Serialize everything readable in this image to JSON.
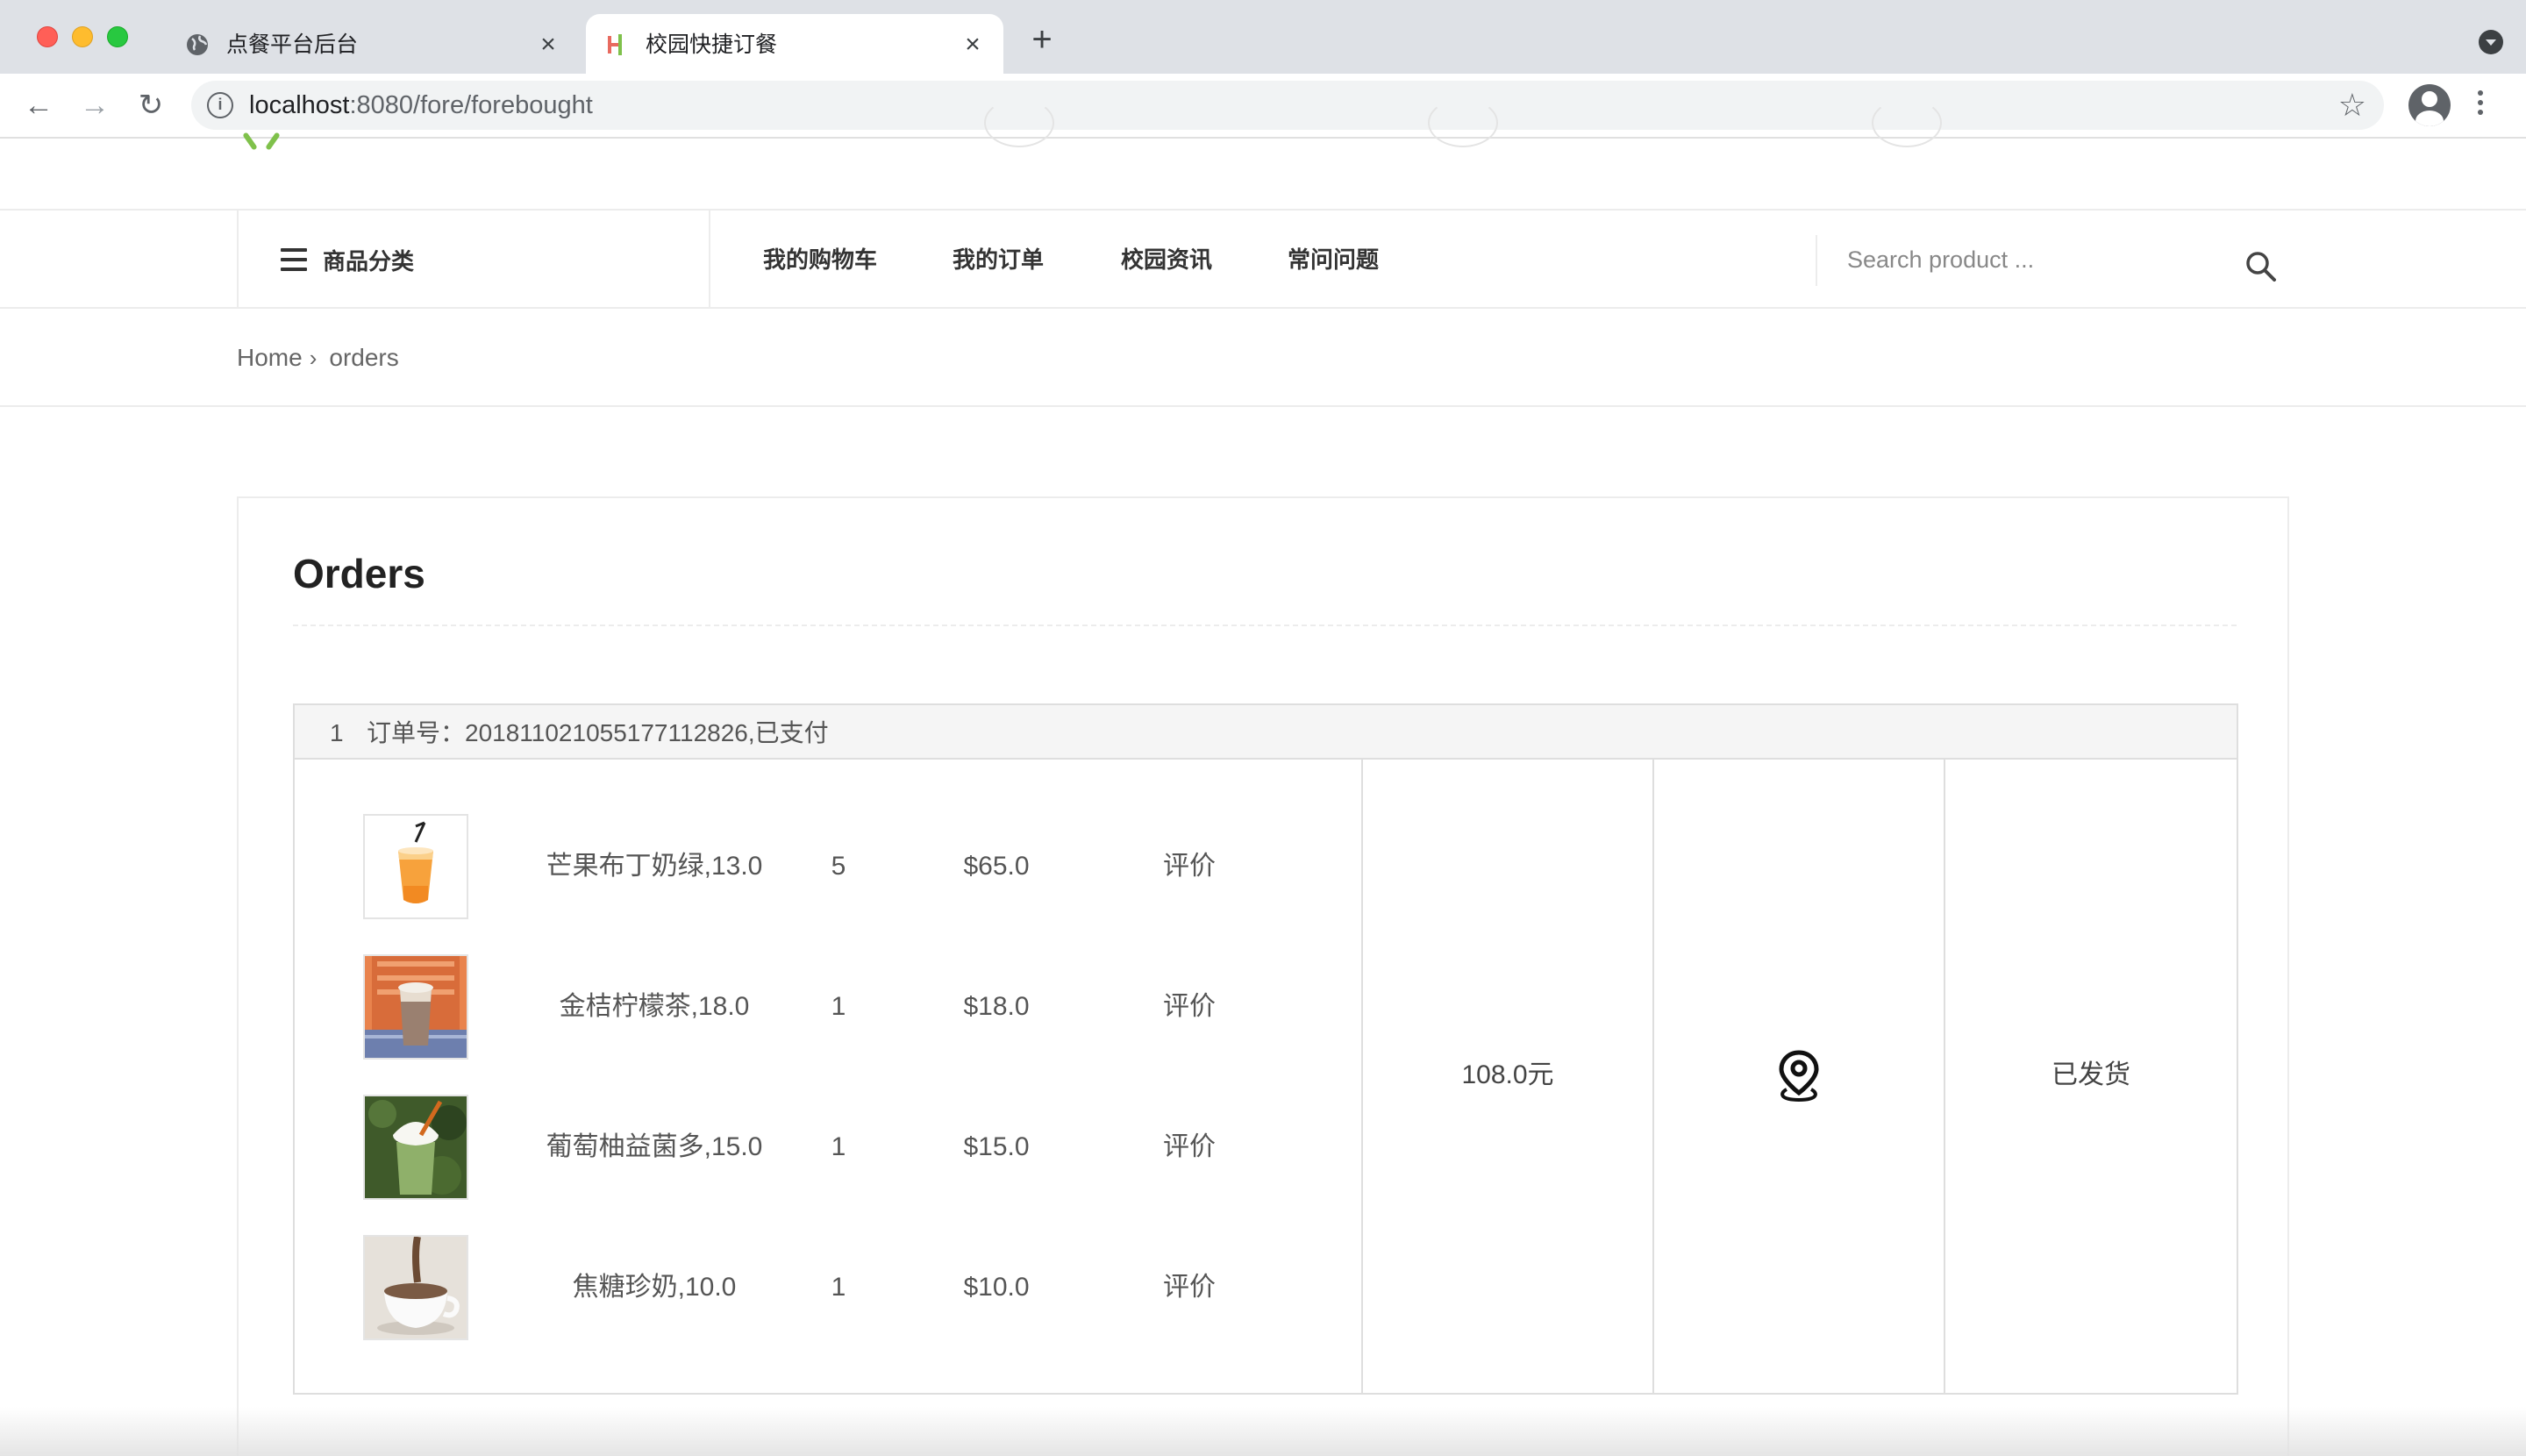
{
  "browser": {
    "tabs": [
      {
        "title": "点餐平台后台",
        "active": false,
        "icon": "globe-icon"
      },
      {
        "title": "校园快捷订餐",
        "active": true,
        "icon": "site-logo-icon"
      }
    ],
    "url_host": "localhost",
    "url_path": ":8080/fore/forebought"
  },
  "navbar": {
    "category_label": "商品分类",
    "menu": [
      "我的购物车",
      "我的订单",
      "校园资讯",
      "常问问题"
    ],
    "search_placeholder": "Search product ..."
  },
  "breadcrumb": {
    "home": "Home",
    "current": "orders"
  },
  "orders": {
    "title": "Orders",
    "list": [
      {
        "index": "1",
        "meta": "订单号：20181102105517711282​6,已支付",
        "items": [
          {
            "name": "芒果布丁奶绿,13.0",
            "qty": "5",
            "price": "$65.0",
            "review": "评价",
            "image": "mango-pudding-milk-green-tea"
          },
          {
            "name": "金桔柠檬茶,18.0",
            "qty": "1",
            "price": "$18.0",
            "review": "评价",
            "image": "kumquat-lemon-tea"
          },
          {
            "name": "葡萄柚益菌多,15.0",
            "qty": "1",
            "price": "$15.0",
            "review": "评价",
            "image": "grapefruit-yakult"
          },
          {
            "name": "焦糖珍奶,10.0",
            "qty": "1",
            "price": "$10.0",
            "review": "评价",
            "image": "caramel-pearl-milk-tea"
          }
        ],
        "total": "108.0元",
        "location_icon": "map-pin-icon",
        "status": "已发货"
      }
    ]
  },
  "colors": {
    "accent_green": "#7fc14b",
    "text": "#333333",
    "border": "#dedede"
  }
}
